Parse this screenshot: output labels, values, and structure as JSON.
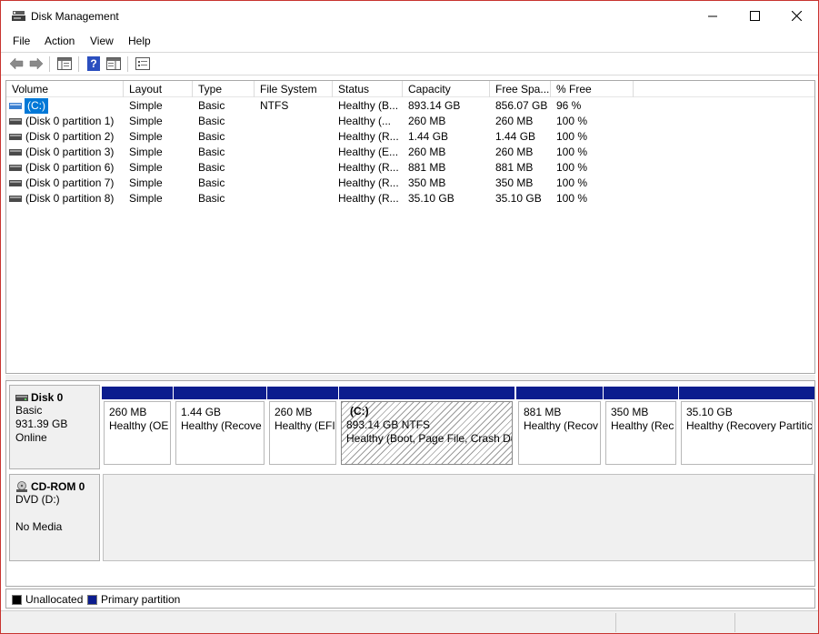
{
  "window": {
    "title": "Disk Management"
  },
  "menu": [
    "File",
    "Action",
    "View",
    "Help"
  ],
  "columns": [
    "Volume",
    "Layout",
    "Type",
    "File System",
    "Status",
    "Capacity",
    "Free Spa...",
    "% Free"
  ],
  "rows": [
    {
      "volume": "(C:)",
      "layout": "Simple",
      "type": "Basic",
      "fs": "NTFS",
      "status": "Healthy (B...",
      "capacity": "893.14 GB",
      "free": "856.07 GB",
      "pct": "96 %"
    },
    {
      "volume": "(Disk 0 partition 1)",
      "layout": "Simple",
      "type": "Basic",
      "fs": "",
      "status": "Healthy (...",
      "capacity": "260 MB",
      "free": "260 MB",
      "pct": "100 %"
    },
    {
      "volume": "(Disk 0 partition 2)",
      "layout": "Simple",
      "type": "Basic",
      "fs": "",
      "status": "Healthy (R...",
      "capacity": "1.44 GB",
      "free": "1.44 GB",
      "pct": "100 %"
    },
    {
      "volume": "(Disk 0 partition 3)",
      "layout": "Simple",
      "type": "Basic",
      "fs": "",
      "status": "Healthy (E...",
      "capacity": "260 MB",
      "free": "260 MB",
      "pct": "100 %"
    },
    {
      "volume": "(Disk 0 partition 6)",
      "layout": "Simple",
      "type": "Basic",
      "fs": "",
      "status": "Healthy (R...",
      "capacity": "881 MB",
      "free": "881 MB",
      "pct": "100 %"
    },
    {
      "volume": "(Disk 0 partition 7)",
      "layout": "Simple",
      "type": "Basic",
      "fs": "",
      "status": "Healthy (R...",
      "capacity": "350 MB",
      "free": "350 MB",
      "pct": "100 %"
    },
    {
      "volume": "(Disk 0 partition 8)",
      "layout": "Simple",
      "type": "Basic",
      "fs": "",
      "status": "Healthy (R...",
      "capacity": "35.10 GB",
      "free": "35.10 GB",
      "pct": "100 %"
    }
  ],
  "disk0": {
    "name": "Disk 0",
    "type": "Basic",
    "size": "931.39 GB",
    "state": "Online",
    "partitions": [
      {
        "title": "",
        "line1": "260 MB",
        "line2": "Healthy (OE"
      },
      {
        "title": "",
        "line1": "1.44 GB",
        "line2": "Healthy (Recove"
      },
      {
        "title": "",
        "line1": "260 MB",
        "line2": "Healthy (EFI"
      },
      {
        "title": "(C:)",
        "line1": "893.14 GB NTFS",
        "line2": "Healthy (Boot, Page File, Crash Du"
      },
      {
        "title": "",
        "line1": "881 MB",
        "line2": "Healthy (Recov"
      },
      {
        "title": "",
        "line1": "350 MB",
        "line2": "Healthy (Rec"
      },
      {
        "title": "",
        "line1": "35.10 GB",
        "line2": "Healthy (Recovery Partitic"
      }
    ]
  },
  "cdrom": {
    "name": "CD-ROM 0",
    "drive": "DVD (D:)",
    "media": "No Media"
  },
  "legend": [
    {
      "label": "Unallocated",
      "color": "#000000"
    },
    {
      "label": "Primary partition",
      "color": "#0c1d8e"
    }
  ],
  "colors": {
    "selection": "#0078d7",
    "partition_header": "#0c1d8e",
    "window_border": "#c8342f"
  }
}
